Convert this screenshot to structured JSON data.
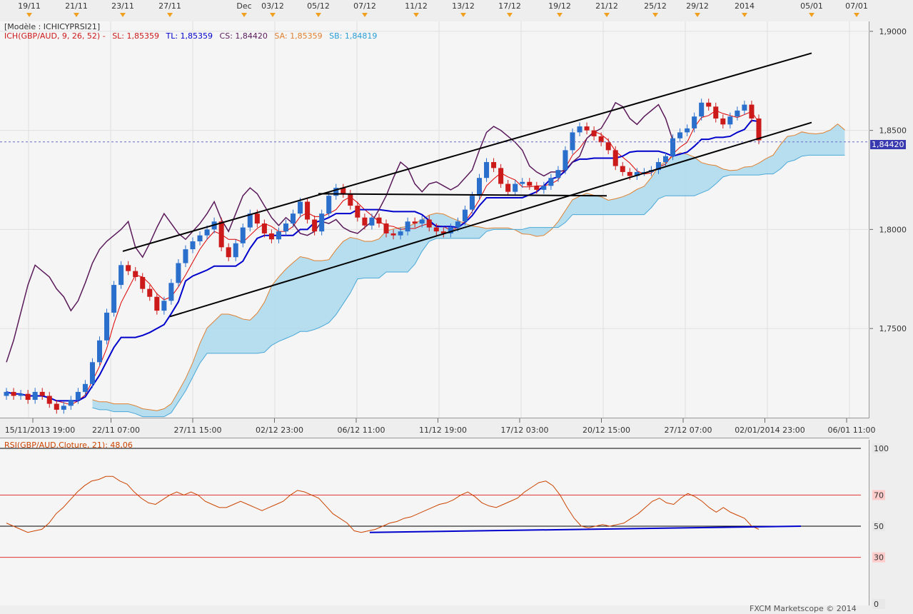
{
  "header": {
    "top_dates": [
      "19/11",
      "21/11",
      "23/11",
      "27/11",
      "Dec",
      "03/12",
      "05/12",
      "07/12",
      "11/12",
      "13/12",
      "17/12",
      "19/12",
      "21/12",
      "25/12",
      "29/12",
      "2014",
      "05/01",
      "07/01"
    ]
  },
  "legend": {
    "model": "[Modèle : ICHICYPRSI21]",
    "ichimoku": "ICH(GBP/AUD, 9, 26, 52) -",
    "sl": "SL: 1,85359",
    "tl": "TL: 1,85359",
    "cs": "CS: 1,84420",
    "sa": "SA: 1,85359",
    "sb": "SB: 1,84819"
  },
  "price_axis": {
    "labels": [
      "1,9000",
      "1,8500",
      "1,8000",
      "1,7500"
    ],
    "current_price": "1,84420"
  },
  "time_axis": {
    "labels": [
      "15/11/2013 19:00",
      "22/11 07:00",
      "27/11 15:00",
      "02/12 23:00",
      "06/12 11:00",
      "11/12 19:00",
      "17/12 03:00",
      "20/12 15:00",
      "27/12 07:00",
      "02/01/2014 23:00",
      "06/01 11:00"
    ]
  },
  "rsi": {
    "legend": "RSI(GBP/AUD.Cloture, 21): 48,06",
    "levels": [
      "100",
      "70",
      "50",
      "30",
      "0"
    ]
  },
  "footer": {
    "brand": "FXCM Marketscope © 2014"
  },
  "colors": {
    "tenkan": "#dd0000",
    "kijun": "#0000cc",
    "chikou": "#5a1a5a",
    "senkou_a": "#e08030",
    "senkou_b": "#4aa8d8",
    "cloud": "#a8d8ee",
    "bull": "#2a6fcc",
    "bear": "#cc1a1a",
    "rsi": "#cc4400"
  },
  "chart_data": [
    {
      "type": "candlestick",
      "title": "",
      "symbol": "GBP/AUD",
      "ylim": [
        1.705,
        1.905
      ],
      "series": [
        {
          "name": "Close",
          "values": [
            1.718,
            1.716,
            1.717,
            1.714,
            1.718,
            1.716,
            1.712,
            1.709,
            1.711,
            1.714,
            1.718,
            1.722,
            1.733,
            1.744,
            1.758,
            1.772,
            1.782,
            1.779,
            1.776,
            1.77,
            1.766,
            1.759,
            1.764,
            1.773,
            1.783,
            1.79,
            1.794,
            1.797,
            1.8,
            1.804,
            1.791,
            1.786,
            1.793,
            1.801,
            1.808,
            1.803,
            1.798,
            1.795,
            1.799,
            1.803,
            1.808,
            1.814,
            1.805,
            1.799,
            1.808,
            1.817,
            1.821,
            1.818,
            1.812,
            1.806,
            1.802,
            1.806,
            1.803,
            1.798,
            1.797,
            1.799,
            1.804,
            1.803,
            1.805,
            1.801,
            1.799,
            1.798,
            1.801,
            1.804,
            1.81,
            1.817,
            1.826,
            1.834,
            1.831,
            1.823,
            1.819,
            1.823,
            1.824,
            1.822,
            1.82,
            1.822,
            1.826,
            1.83,
            1.84,
            1.849,
            1.852,
            1.85,
            1.847,
            1.844,
            1.84,
            1.832,
            1.829,
            1.827,
            1.829,
            1.829,
            1.83,
            1.834,
            1.837,
            1.846,
            1.849,
            1.851,
            1.857,
            1.864,
            1.862,
            1.856,
            1.853,
            1.857,
            1.86,
            1.863,
            1.856,
            1.845
          ]
        }
      ],
      "indicators": {
        "tenkan_sen": 1.85359,
        "kijun_sen": 1.85359,
        "chikou_span": 1.8442,
        "senkou_span_a": 1.85359,
        "senkou_span_b": 1.84819
      },
      "trendlines": [
        {
          "name": "upper channel",
          "from": [
            "23/11",
            1.789
          ],
          "to": [
            "05/01",
            1.889
          ]
        },
        {
          "name": "lower channel",
          "from": [
            "27/11",
            1.756
          ],
          "to": [
            "05/01",
            1.854
          ]
        },
        {
          "name": "horizontal support",
          "from": [
            "05/12",
            1.818
          ],
          "to": [
            "21/12",
            1.817
          ]
        }
      ]
    },
    {
      "type": "line",
      "title": "RSI(GBP/AUD.Cloture, 21): 48,06",
      "ylim": [
        0,
        100
      ],
      "levels": [
        30,
        50,
        70,
        100
      ],
      "series": [
        {
          "name": "RSI",
          "values": [
            52,
            50,
            48,
            46,
            47,
            48,
            52,
            58,
            62,
            67,
            72,
            76,
            79,
            80,
            82,
            82,
            79,
            77,
            72,
            68,
            65,
            64,
            67,
            70,
            72,
            70,
            72,
            70,
            66,
            64,
            62,
            62,
            64,
            66,
            64,
            62,
            60,
            62,
            64,
            66,
            70,
            73,
            72,
            70,
            68,
            63,
            58,
            55,
            52,
            47,
            46,
            47,
            48,
            50,
            52,
            53,
            55,
            56,
            58,
            60,
            62,
            64,
            65,
            67,
            70,
            72,
            69,
            65,
            63,
            62,
            64,
            66,
            68,
            72,
            75,
            78,
            79,
            76,
            70,
            62,
            55,
            50,
            49,
            50,
            51,
            50,
            51,
            52,
            55,
            58,
            62,
            66,
            68,
            65,
            64,
            68,
            71,
            69,
            66,
            62,
            59,
            62,
            59,
            57,
            55,
            50,
            48
          ]
        }
      ],
      "trendlines": [
        {
          "name": "rsi support",
          "from": 46,
          "to": 50
        }
      ]
    }
  ]
}
